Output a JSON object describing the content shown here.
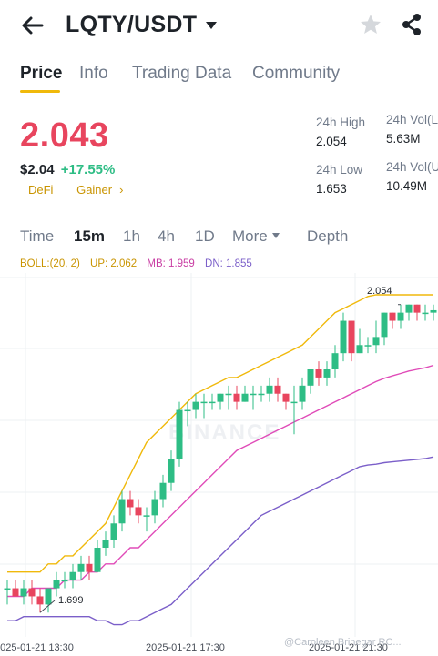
{
  "header": {
    "pair": "LQTY/USDT",
    "icons": [
      "back-arrow-icon",
      "chevron-down-icon",
      "star-icon",
      "share-icon"
    ]
  },
  "tabs": [
    "Price",
    "Info",
    "Trading Data",
    "Community"
  ],
  "price": {
    "last": "2.043",
    "fiat": "$2.04",
    "change": "+17.55%",
    "tags": [
      "DeFi",
      "Gainer"
    ],
    "tag_arrow": "›"
  },
  "stats": {
    "high_label": "24h High",
    "high_value": "2.054",
    "low_label": "24h Low",
    "low_value": "1.653",
    "vol1_label": "24h Vol(L",
    "vol1_value": "5.63M",
    "vol2_label": "24h Vol(U",
    "vol2_value": "10.49M"
  },
  "intervals": [
    "Time",
    "15m",
    "1h",
    "4h",
    "1D",
    "More",
    "Depth"
  ],
  "boll": {
    "params": "BOLL:(20, 2)",
    "up": "UP: 2.062",
    "mb": "MB: 1.959",
    "dn": "DN: 1.855"
  },
  "chart": {
    "high_marker": "2.054",
    "low_marker": "1.699",
    "x_labels": [
      "2025-01-21 13:30",
      "2025-01-21 17:30",
      "2025-01-21 21:30"
    ],
    "watermark": "BINANCE",
    "credit": "@Caroleen Brinegar RC..."
  },
  "colors": {
    "up": "#2ebd85",
    "down": "#e8455e",
    "boll_up": "#f0b90b",
    "boll_mb": "#e04bb8",
    "boll_dn": "#7b5fc9",
    "accent": "#f0b90b"
  },
  "chart_data": {
    "type": "candlestick",
    "candles": [
      [
        1.7,
        1.71,
        1.68,
        1.7
      ],
      [
        1.7,
        1.71,
        1.69,
        1.69
      ],
      [
        1.69,
        1.71,
        1.68,
        1.7
      ],
      [
        1.7,
        1.71,
        1.68,
        1.69
      ],
      [
        1.69,
        1.7,
        1.67,
        1.68
      ],
      [
        1.68,
        1.7,
        1.67,
        1.7
      ],
      [
        1.7,
        1.72,
        1.69,
        1.71
      ],
      [
        1.71,
        1.72,
        1.7,
        1.71
      ],
      [
        1.71,
        1.73,
        1.7,
        1.72
      ],
      [
        1.72,
        1.74,
        1.71,
        1.73
      ],
      [
        1.73,
        1.74,
        1.71,
        1.72
      ],
      [
        1.72,
        1.76,
        1.72,
        1.75
      ],
      [
        1.75,
        1.77,
        1.74,
        1.76
      ],
      [
        1.76,
        1.79,
        1.75,
        1.78
      ],
      [
        1.78,
        1.82,
        1.77,
        1.81
      ],
      [
        1.81,
        1.82,
        1.79,
        1.8
      ],
      [
        1.8,
        1.81,
        1.78,
        1.79
      ],
      [
        1.79,
        1.8,
        1.77,
        1.79
      ],
      [
        1.79,
        1.82,
        1.78,
        1.81
      ],
      [
        1.81,
        1.84,
        1.8,
        1.83
      ],
      [
        1.83,
        1.87,
        1.82,
        1.86
      ],
      [
        1.86,
        1.93,
        1.85,
        1.92
      ],
      [
        1.92,
        1.93,
        1.9,
        1.92
      ],
      [
        1.92,
        1.94,
        1.91,
        1.93
      ],
      [
        1.93,
        1.94,
        1.91,
        1.93
      ],
      [
        1.93,
        1.94,
        1.92,
        1.93
      ],
      [
        1.93,
        1.94,
        1.92,
        1.94
      ],
      [
        1.94,
        1.95,
        1.92,
        1.94
      ],
      [
        1.94,
        1.95,
        1.92,
        1.93
      ],
      [
        1.93,
        1.95,
        1.93,
        1.94
      ],
      [
        1.94,
        1.95,
        1.92,
        1.94
      ],
      [
        1.94,
        1.95,
        1.93,
        1.94
      ],
      [
        1.94,
        1.96,
        1.93,
        1.95
      ],
      [
        1.95,
        1.96,
        1.93,
        1.94
      ],
      [
        1.94,
        1.94,
        1.92,
        1.93
      ],
      [
        1.93,
        1.95,
        1.89,
        1.93
      ],
      [
        1.93,
        1.96,
        1.92,
        1.95
      ],
      [
        1.95,
        1.97,
        1.94,
        1.97
      ],
      [
        1.97,
        1.98,
        1.95,
        1.96
      ],
      [
        1.96,
        1.98,
        1.95,
        1.97
      ],
      [
        1.97,
        2.0,
        1.96,
        1.99
      ],
      [
        1.99,
        2.04,
        1.98,
        2.03
      ],
      [
        2.03,
        2.03,
        1.98,
        1.99
      ],
      [
        1.99,
        2.02,
        1.99,
        2.0
      ],
      [
        2.0,
        2.01,
        1.99,
        2.0
      ],
      [
        2.0,
        2.03,
        1.99,
        2.01
      ],
      [
        2.01,
        2.04,
        2.0,
        2.04
      ],
      [
        2.04,
        2.04,
        2.02,
        2.03
      ],
      [
        2.03,
        2.05,
        2.02,
        2.04
      ],
      [
        2.04,
        2.05,
        2.03,
        2.05
      ],
      [
        2.05,
        2.05,
        2.03,
        2.04
      ],
      [
        2.04,
        2.05,
        2.03,
        2.04
      ],
      [
        2.04,
        2.05,
        2.03,
        2.043
      ]
    ],
    "boll_up": [
      1.72,
      1.72,
      1.72,
      1.72,
      1.72,
      1.73,
      1.73,
      1.74,
      1.74,
      1.75,
      1.76,
      1.77,
      1.78,
      1.8,
      1.82,
      1.84,
      1.86,
      1.88,
      1.89,
      1.9,
      1.91,
      1.92,
      1.93,
      1.94,
      1.945,
      1.95,
      1.955,
      1.96,
      1.96,
      1.965,
      1.97,
      1.975,
      1.98,
      1.985,
      1.99,
      1.995,
      2.0,
      2.01,
      2.02,
      2.03,
      2.04,
      2.045,
      2.05,
      2.055,
      2.06,
      2.062,
      2.062,
      2.062,
      2.062,
      2.062,
      2.062,
      2.062,
      2.062
    ],
    "boll_mb": [
      1.69,
      1.69,
      1.69,
      1.7,
      1.7,
      1.7,
      1.7,
      1.71,
      1.71,
      1.71,
      1.72,
      1.72,
      1.73,
      1.73,
      1.74,
      1.75,
      1.75,
      1.76,
      1.77,
      1.78,
      1.79,
      1.8,
      1.81,
      1.82,
      1.83,
      1.84,
      1.85,
      1.86,
      1.87,
      1.875,
      1.88,
      1.885,
      1.89,
      1.895,
      1.9,
      1.905,
      1.91,
      1.915,
      1.92,
      1.925,
      1.93,
      1.935,
      1.94,
      1.945,
      1.95,
      1.955,
      1.959,
      1.962,
      1.965,
      1.968,
      1.97,
      1.972,
      1.975
    ],
    "boll_dn": [
      1.66,
      1.66,
      1.665,
      1.665,
      1.665,
      1.665,
      1.665,
      1.665,
      1.665,
      1.665,
      1.665,
      1.66,
      1.66,
      1.655,
      1.655,
      1.66,
      1.66,
      1.665,
      1.67,
      1.675,
      1.68,
      1.69,
      1.7,
      1.71,
      1.72,
      1.73,
      1.74,
      1.75,
      1.76,
      1.77,
      1.78,
      1.79,
      1.795,
      1.8,
      1.805,
      1.81,
      1.815,
      1.82,
      1.825,
      1.83,
      1.835,
      1.84,
      1.845,
      1.85,
      1.852,
      1.853,
      1.855,
      1.856,
      1.857,
      1.858,
      1.859,
      1.86,
      1.862
    ],
    "y_range": [
      1.64,
      2.08
    ],
    "x_labels": [
      "2025-01-21 13:30",
      "2025-01-21 17:30",
      "2025-01-21 21:30"
    ]
  }
}
